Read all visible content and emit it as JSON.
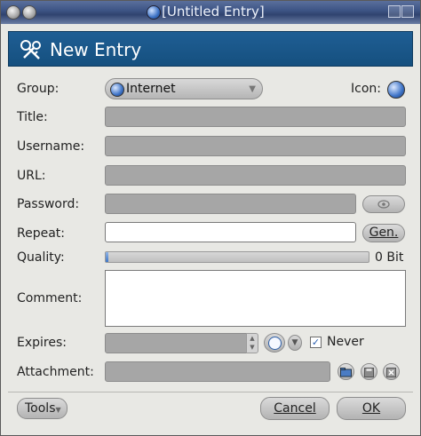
{
  "window": {
    "title": "[Untitled Entry]"
  },
  "header": {
    "title": "New Entry"
  },
  "form": {
    "group_label": "Group:",
    "group_value": "Internet",
    "icon_label": "Icon:",
    "title_label": "Title:",
    "username_label": "Username:",
    "url_label": "URL:",
    "password_label": "Password:",
    "repeat_label": "Repeat:",
    "gen_button": "Gen.",
    "quality_label": "Quality:",
    "quality_value": "0 Bit",
    "quality_fraction": 0.01,
    "comment_label": "Comment:",
    "expires_label": "Expires:",
    "never_label": "Never",
    "never_checked": "✓",
    "attachment_label": "Attachment:"
  },
  "footer": {
    "tools_button": "Tools",
    "cancel_button": "Cancel",
    "ok_button": "OK"
  },
  "colors": {
    "header_bg": "#1a5a8f",
    "field_disabled": "#a6a6a6",
    "quality_fill": "#3f77c6"
  }
}
